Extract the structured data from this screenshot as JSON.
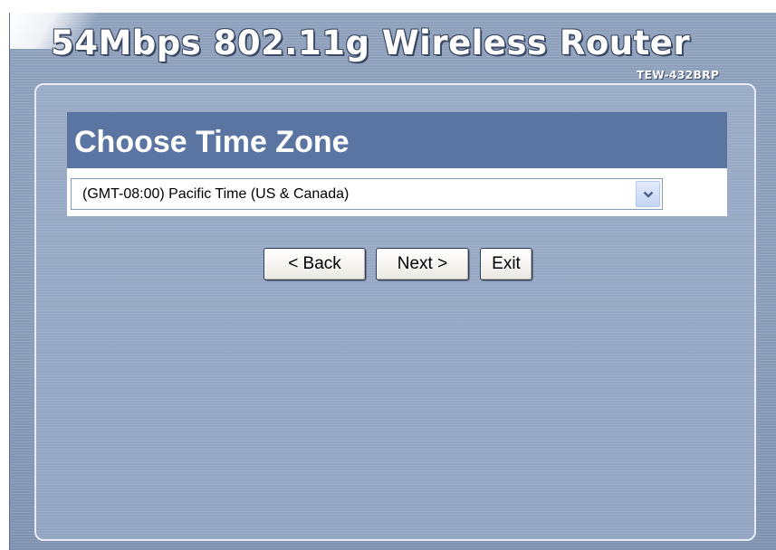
{
  "header": {
    "title": "54Mbps 802.11g Wireless Router",
    "model": "TEW-432BRP"
  },
  "section": {
    "title": "Choose Time Zone"
  },
  "timezone": {
    "selected": "(GMT-08:00) Pacific Time (US & Canada)"
  },
  "buttons": {
    "back": "< Back",
    "next": "Next >",
    "exit": "Exit"
  },
  "colors": {
    "panel_bg": "#8ea0bb",
    "section_bar": "#5b75a3",
    "title_text": "#ffffff"
  },
  "icons": {
    "dropdown": "chevron-down-icon"
  }
}
